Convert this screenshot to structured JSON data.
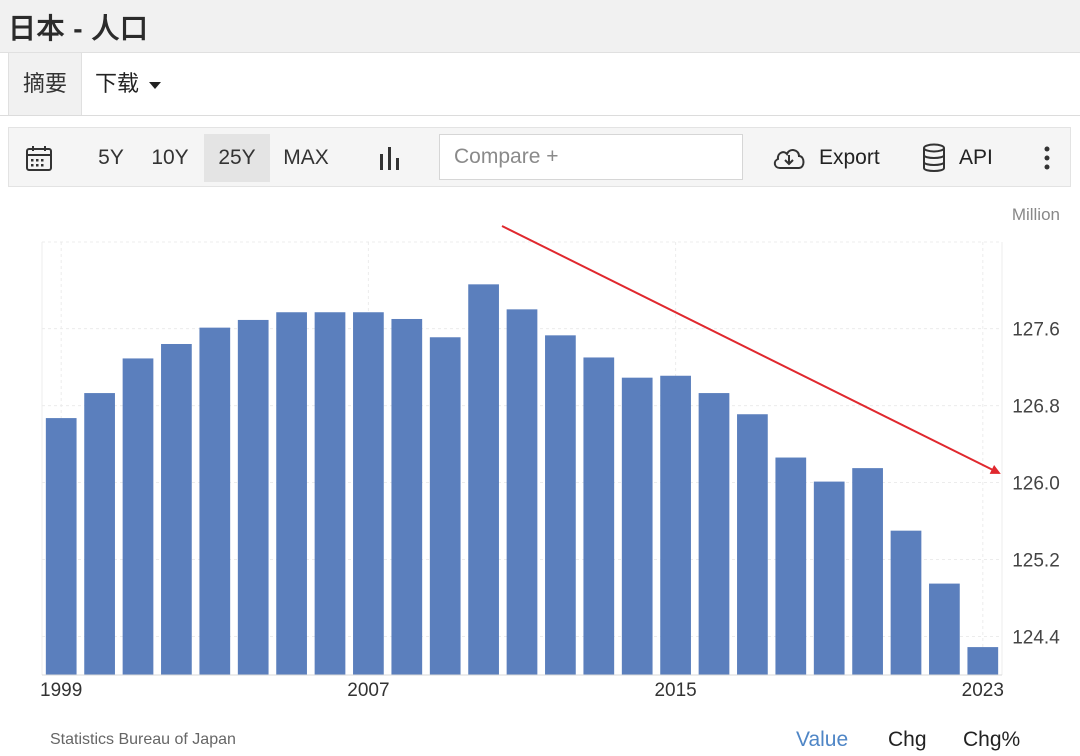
{
  "header": {
    "title": "日本 - 人口"
  },
  "tabs": {
    "summary_label": "摘要",
    "download_label": "下载"
  },
  "toolbar": {
    "ranges": [
      "5Y",
      "10Y",
      "25Y",
      "MAX"
    ],
    "active_range": "25Y",
    "compare_placeholder": "Compare +",
    "export_label": "Export",
    "api_label": "API"
  },
  "chart_data": {
    "type": "bar",
    "title": "",
    "xlabel": "",
    "ylabel": "",
    "unit_label": "Million",
    "categories": [
      "1999",
      "2000",
      "2001",
      "2002",
      "2003",
      "2004",
      "2005",
      "2006",
      "2007",
      "2008",
      "2009",
      "2010",
      "2011",
      "2012",
      "2013",
      "2014",
      "2015",
      "2016",
      "2017",
      "2018",
      "2019",
      "2020",
      "2021",
      "2022",
      "2023"
    ],
    "values": [
      126.67,
      126.93,
      127.29,
      127.44,
      127.61,
      127.69,
      127.77,
      127.77,
      127.77,
      127.7,
      127.51,
      128.06,
      127.8,
      127.53,
      127.3,
      127.09,
      127.11,
      126.93,
      126.71,
      126.26,
      126.01,
      126.15,
      125.5,
      124.95,
      124.29
    ],
    "x_tick_labels": [
      "1999",
      "2007",
      "2015",
      "2023"
    ],
    "y_ticks": [
      124.4,
      125.2,
      126.0,
      126.8,
      127.6
    ],
    "y_tick_labels": [
      "124.4",
      "125.2",
      "126.0",
      "126.8",
      "127.6"
    ],
    "ylim": [
      124.0,
      128.5
    ],
    "grid": true,
    "bar_color": "#5b7fbd",
    "trend_arrow_color": "#e0282e",
    "legend": "none"
  },
  "footer": {
    "source": "Statistics Bureau of Japan",
    "tabs": [
      "Value",
      "Chg",
      "Chg%"
    ],
    "active_tab": "Value",
    "active_color": "#4f86c6"
  }
}
